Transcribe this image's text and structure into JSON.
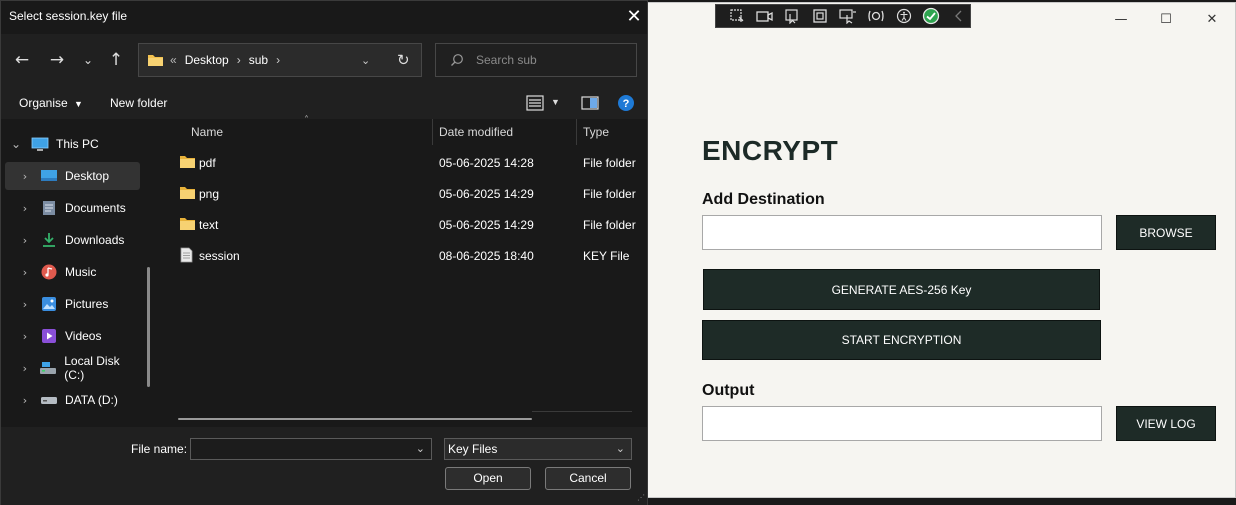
{
  "app": {
    "title_controls": {
      "minimize": "—",
      "maximize": "☐",
      "close": "✕"
    },
    "heading": "ENCRYPT",
    "destination_label": "Add Destination",
    "destination_value": "",
    "browse_label": "BROWSE",
    "generate_label": "GENERATE AES-256 Key",
    "start_label": "START ENCRYPTION",
    "output_label": "Output",
    "output_value": "",
    "view_log_label": "VIEW LOG"
  },
  "toolbar": {
    "icons": [
      "add-element-icon",
      "record-icon",
      "select-element-icon",
      "inspect-icon",
      "highlight-icon",
      "options-icon",
      "accessibility-icon",
      "check-icon",
      "collapse-icon"
    ]
  },
  "dialog": {
    "title": "Select session.key file",
    "address": {
      "prefix": "«",
      "crumbs": [
        "Desktop",
        "sub"
      ]
    },
    "search_placeholder": "Search sub",
    "commands": {
      "organise": "Organise",
      "new_folder": "New folder"
    },
    "tree": [
      {
        "label": "This PC",
        "icon": "computer-icon",
        "expanded": true
      },
      {
        "label": "Desktop",
        "icon": "desktop-icon",
        "selected": true
      },
      {
        "label": "Documents",
        "icon": "documents-icon"
      },
      {
        "label": "Downloads",
        "icon": "downloads-icon"
      },
      {
        "label": "Music",
        "icon": "music-icon"
      },
      {
        "label": "Pictures",
        "icon": "pictures-icon"
      },
      {
        "label": "Videos",
        "icon": "videos-icon"
      },
      {
        "label": "Local Disk (C:)",
        "icon": "local-disk-icon"
      },
      {
        "label": "DATA (D:)",
        "icon": "drive-icon"
      }
    ],
    "columns": {
      "name": "Name",
      "date": "Date modified",
      "type": "Type"
    },
    "files": [
      {
        "name": "pdf",
        "date": "05-06-2025 14:28",
        "type": "File folder",
        "icon": "folder-icon"
      },
      {
        "name": "png",
        "date": "05-06-2025 14:29",
        "type": "File folder",
        "icon": "folder-icon"
      },
      {
        "name": "text",
        "date": "05-06-2025 14:29",
        "type": "File folder",
        "icon": "folder-icon"
      },
      {
        "name": "session",
        "date": "08-06-2025 18:40",
        "type": "KEY File",
        "icon": "file-icon"
      }
    ],
    "filename_label": "File name:",
    "filename_value": "",
    "filter_value": "Key Files",
    "open_label": "Open",
    "cancel_label": "Cancel"
  },
  "colors": {
    "dialog_bg": "#191919",
    "app_bg": "#f6f5f1",
    "app_button": "#1e2b27",
    "folder": "#f2c14e",
    "accent_blue": "#1e7ad6"
  }
}
